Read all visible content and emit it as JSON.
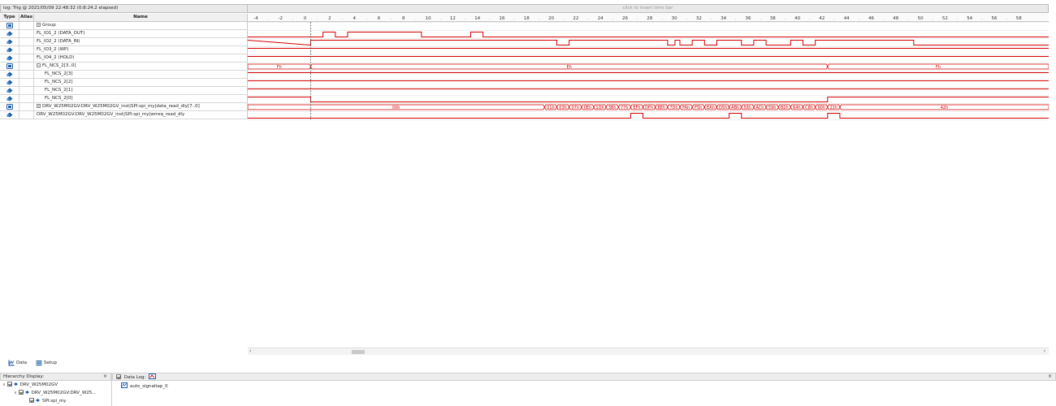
{
  "header": {
    "trigger_info": "log: Trig @ 2021/05/09 22:48:32 (0:8:24.2 elapsed)",
    "timebar_hint": "click to insert time bar"
  },
  "columns": {
    "type": "Type",
    "alias": "Alias",
    "name": "Name"
  },
  "timeline": {
    "ticks": [
      "-4",
      "-2",
      "0",
      "2",
      "4",
      "6",
      "8",
      "10",
      "12",
      "14",
      "16",
      "18",
      "20",
      "22",
      "24",
      "26",
      "28",
      "30",
      "32",
      "34",
      "36",
      "38",
      "40",
      "42",
      "44",
      "46",
      "48",
      "50",
      "52",
      "54",
      "56",
      "58"
    ],
    "colors": {
      "signal": "#d40000",
      "trigger_line": "#555555",
      "grid": "#dddddd"
    }
  },
  "rows": [
    {
      "name": "Group",
      "expander": "+",
      "indent": 0
    },
    {
      "name": "FL_IO1_2 (DATA_OUT)",
      "expander": "",
      "indent": 0
    },
    {
      "name": "FL_IO2_2 (DATA_IN)",
      "expander": "",
      "indent": 0
    },
    {
      "name": "FL_IO3_2 (WP)",
      "expander": "",
      "indent": 0
    },
    {
      "name": "FL_IO4_2 (HOLD)",
      "expander": "",
      "indent": 0
    },
    {
      "name": "FL_NCS_2[3..0]",
      "expander": "−",
      "indent": 0
    },
    {
      "name": "FL_NCS_2[3]",
      "expander": "",
      "indent": 2
    },
    {
      "name": "FL_NCS_2[2]",
      "expander": "",
      "indent": 2
    },
    {
      "name": "FL_NCS_2[1]",
      "expander": "",
      "indent": 2
    },
    {
      "name": "FL_NCS_2[0]",
      "expander": "",
      "indent": 2
    },
    {
      "name": "DRV_W25M02GV:DRV_W25M02GV_inst|SPI:spi_my|data_read_dly[7..0]",
      "expander": "+",
      "indent": 0
    },
    {
      "name": "DRV_W25M02GV:DRV_W25M02GV_inst|SPI:spi_my|wrreq_read_dly",
      "expander": "",
      "indent": 0
    }
  ],
  "bus_labels": {
    "ncs": [
      "Fh",
      "Eh",
      "Fh"
    ],
    "data": [
      "00h",
      "01h",
      "03h",
      "07h",
      "0Eh",
      "1Dh",
      "3Bh",
      "77h",
      "EFh",
      "DFh",
      "BEh",
      "7Dh",
      "FAh",
      "F5h",
      "EAh",
      "D5h",
      "ABh",
      "56h",
      "ACh",
      "59h",
      "B2h",
      "64h",
      "C8h",
      "90h",
      "21h",
      "42h"
    ]
  },
  "scrollbar": {
    "left_arrow": "‹",
    "right_arrow": "›"
  },
  "tabs": [
    {
      "label": "Data",
      "icon": "data-icon"
    },
    {
      "label": "Setup",
      "icon": "setup-icon"
    }
  ],
  "hierarchy": {
    "title": "Hierarchy Display:",
    "close": "×",
    "items": [
      {
        "label": "DRV_W25M02GV",
        "level": 0
      },
      {
        "label": "DRV_W25M02GV:DRV_W25...",
        "level": 1
      },
      {
        "label": "SPI:spi_my",
        "level": 2
      }
    ]
  },
  "data_log": {
    "title": "Data Log:",
    "close": "×",
    "items": [
      {
        "label": "auto_signaltap_0"
      }
    ]
  }
}
